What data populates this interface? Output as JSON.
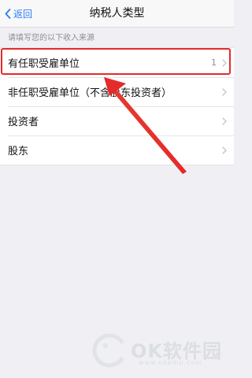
{
  "nav": {
    "back_label": "返回",
    "title": "纳税人类型"
  },
  "section": {
    "header": "请填写您的以下收入来源"
  },
  "list": {
    "items": [
      {
        "label": "有任职受雇单位",
        "count": "1"
      },
      {
        "label": "非任职受雇单位（不含股东投资者）",
        "count": ""
      },
      {
        "label": "投资者",
        "count": ""
      },
      {
        "label": "股东",
        "count": ""
      }
    ]
  },
  "annotation": {
    "highlight_color": "#e52a2a",
    "highlighted_item": "有任职受雇单位"
  },
  "colors": {
    "accent": "#2b7cf6",
    "background": "#efeff4"
  },
  "watermark": {
    "brand": "OK软件园",
    "url": "www.okemu.com"
  }
}
